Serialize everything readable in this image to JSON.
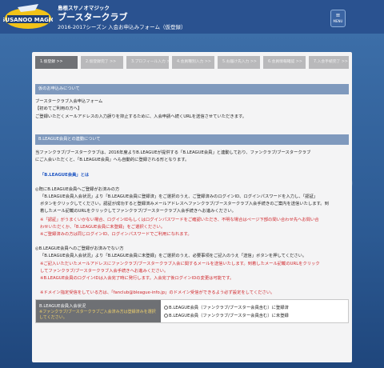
{
  "header": {
    "org": "島根スサノオマジック",
    "title": "ブースタークラブ",
    "subtitle": "2016-2017シーズン 入会お申込みフォーム（仮登録）",
    "menu_label": "MENU",
    "logo_text": "SUSANOO MAGIC"
  },
  "steps": [
    "1.仮登録 >>",
    "2.仮登録完了 >>",
    "3.プロフィール入力 >>",
    "4.会員種別入力 >>",
    "5.お届け先入力 >>",
    "6.会員情報確認 >>",
    "7.入会手続完了 >>"
  ],
  "section1": {
    "heading": "仮のお申込みについて",
    "line1": "ブースタークラブ入会申込フォーム",
    "line2": "【初めてご利用の方へ】",
    "line3": "ご登録いただくメールアドレスの入力誤りを抑止するために、入会申請へ続くURLを送信させていただきます。"
  },
  "section2": {
    "heading": "B.LEAGUE会員との連動について",
    "intro1": "当ファンクラブ/ブースタークラブは、2016年度よりB.LEAGUEが提供する「B.LEAGUE会員」と連動しており、ファンクラブ/ブースタークラブ",
    "intro2": "にご入会いただくと、「B.LEAGUE会員」へも自動的に登録される形となります。",
    "what_is": "「B.LEAGUE会員」とは",
    "case1_title": "◎既にB.LEAGUE会員へご登録がお済みの方",
    "case1_l1": "「B.LEAGUE会員入会状況」より「B.LEAGUE会員に登録済」をご選択のうえ、ご登録済みのログインID、ログインパスワードを入力し、「認証」",
    "case1_l2": "ボタンをクリックしてください。認証が成功すると登録済みメールアドレスへファンクラブ/ブースタークラブ入会手続きのご案内を送信いたします。到",
    "case1_l3": "着したメール記載のURLをクリックしてファンクラブ/ブースタークラブ入会手続きへお進みください。",
    "case1_n1": "※「認証」がうまくいかない場合、ログインIDもしくはログインパスワードをご確認いただき、不明な場合はページ下部の問い合わせ先へお問い合",
    "case1_n2": "わせいただくか、「B.LEAGUE会員に未登録」をご選択ください。",
    "case1_n3": "※ご登録済みの方は同じログインID、ログインパスワードでご利用になれます。",
    "case2_title": "◎B.LEAGUE会員へのご登録がお済みでない方",
    "case2_l1": "「B.LEAGUE会員入会状況」より「B.LEAGUE会員に未登録」をご選択のうえ、必要事項をご記入のうえ「送信」ボタンを押してください。",
    "case2_n1": "※ご記入いただいたメールアドレスにファンクラブ/ブースタークラブ入会に関するメールを送信いたします。到着したメール記載のURLをクリック",
    "case2_n2": "してファンクラブ/ブースタークラブ入会手続きへお進みください。",
    "case2_n3": "※B.LEAGUE会員のログインIDは入会完了時に発行します。入会完了後ログインIDの変更は可能です。",
    "domain_note": "※ドメイン指定受信をしている方は、「fanclub@bleague-info.jp」のドメイン受信ができるよう必ず設定をしてください。"
  },
  "membership": {
    "label": "B.LEAGUE会員入会状況",
    "note": "※ファンクラブ/ブースタークラブご入会済み方は登録済みを選択してください。",
    "option1": "B.LEAGUE会員（ファンクラブ/ブースター会員含む）に登録済",
    "option2": "B.LEAGUE会員（ファンクラブ/ブースター会員含む）に未登録"
  }
}
